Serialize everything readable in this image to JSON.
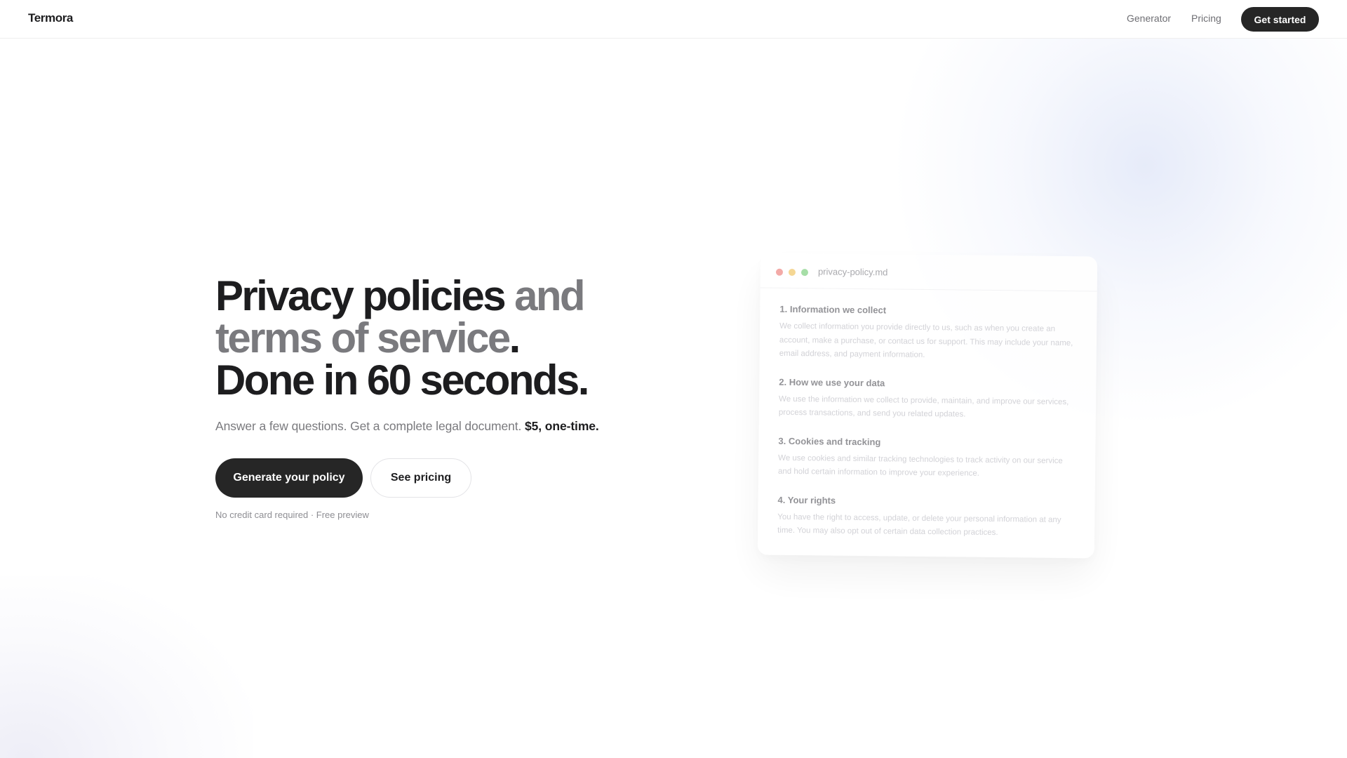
{
  "header": {
    "logo": "Termora",
    "nav": {
      "generator": "Generator",
      "pricing": "Pricing"
    },
    "cta": "Get started"
  },
  "hero": {
    "headline": {
      "line1_dark": "Privacy policies",
      "line1_muted": "and",
      "line2_muted": "terms of service",
      "line2_dark": ".",
      "line3_dark": "Done in 60 seconds."
    },
    "subhead": "Answer a few questions. Get a complete legal document.",
    "price": "$5, one-time.",
    "primary_button": "Generate your policy",
    "secondary_button": "See pricing",
    "fineprint": "No credit card required · Free preview"
  },
  "preview": {
    "filename": "privacy-policy.md",
    "sections": [
      {
        "heading": "1. Information we collect",
        "body": "We collect information you provide directly to us, such as when you create an account, make a purchase, or contact us for support. This may include your name, email address, and payment information."
      },
      {
        "heading": "2. How we use your data",
        "body": "We use the information we collect to provide, maintain, and improve our services, process transactions, and send you related updates."
      },
      {
        "heading": "3. Cookies and tracking",
        "body": "We use cookies and similar tracking technologies to track activity on our service and hold certain information to improve your experience."
      },
      {
        "heading": "4. Your rights",
        "body": "You have the right to access, update, or delete your personal information at any time. You may also opt out of certain data collection practices."
      }
    ]
  }
}
